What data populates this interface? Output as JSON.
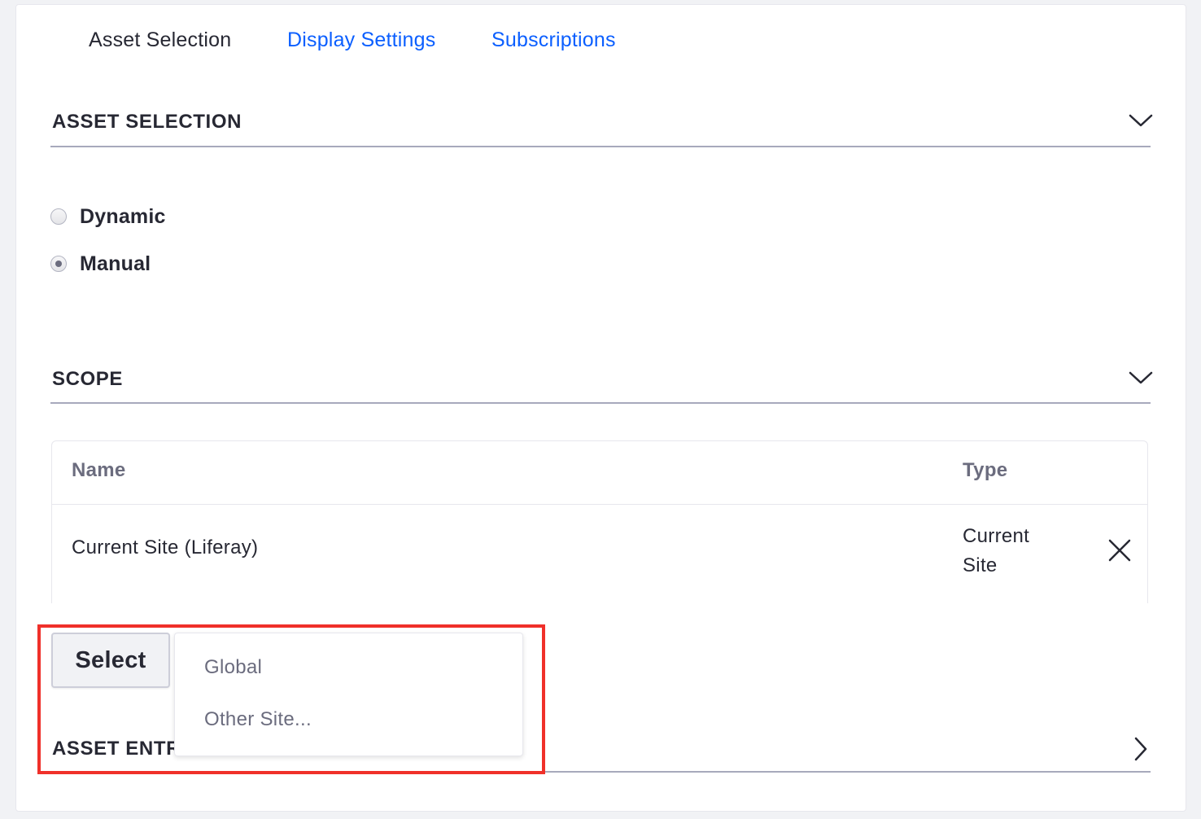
{
  "tabs": [
    {
      "label": "Asset Selection",
      "active": true
    },
    {
      "label": "Display Settings",
      "active": false
    },
    {
      "label": "Subscriptions",
      "active": false
    }
  ],
  "asset_selection": {
    "title": "ASSET SELECTION",
    "toggle_icon": "chevron-down-icon",
    "options": [
      {
        "label": "Dynamic",
        "selected": false
      },
      {
        "label": "Manual",
        "selected": true
      }
    ]
  },
  "scope": {
    "title": "SCOPE",
    "toggle_icon": "chevron-down-icon",
    "table": {
      "headers": [
        "Name",
        "Type"
      ],
      "rows": [
        {
          "name": "Current Site (Liferay)",
          "type": "Current Site",
          "action_icon": "close-icon"
        }
      ]
    },
    "select_button": "Select",
    "dropdown_items": [
      "Global",
      "Other Site..."
    ]
  },
  "asset_entries": {
    "title": "ASSET ENTRIES",
    "toggle_icon": "chevron-right-icon"
  },
  "colors": {
    "link": "#0b5fff",
    "text": "#272833",
    "muted": "#6b6c7e",
    "highlight": "#f0302a",
    "divider": "#a7a9bc"
  }
}
